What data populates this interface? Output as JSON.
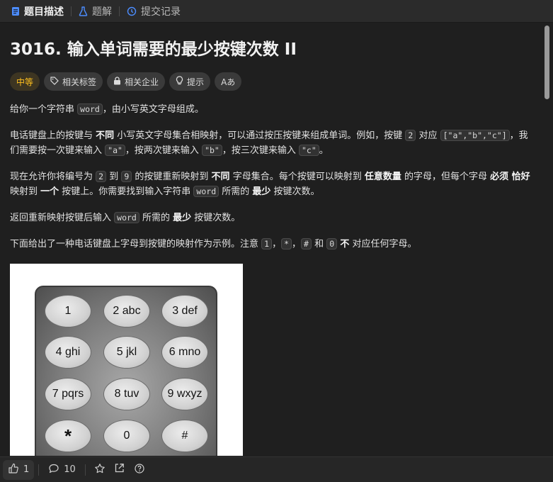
{
  "tabs": [
    {
      "label": "题目描述",
      "icon": "document-icon"
    },
    {
      "label": "题解",
      "icon": "flask-icon"
    },
    {
      "label": "提交记录",
      "icon": "history-icon"
    }
  ],
  "problem": {
    "title": "3016. 输入单词需要的最少按键次数 II",
    "difficulty": "中等",
    "tags": [
      {
        "label": "相关标签",
        "icon": "tag-icon"
      },
      {
        "label": "相关企业",
        "icon": "lock-icon"
      },
      {
        "label": "提示",
        "icon": "lightbulb-icon"
      },
      {
        "label": "Aあ",
        "icon": "translate-icon"
      }
    ],
    "p1": {
      "a": "给你一个字符串 ",
      "code": "word",
      "b": "，由小写英文字母组成。"
    },
    "p2": {
      "a": "电话键盘上的按键与 ",
      "b1": "不同",
      "c": " 小写英文字母集合相映射，可以通过按压按键来组成单词。例如，按键 ",
      "code1": "2",
      "d": " 对应 ",
      "code2": "[\"a\",\"b\",\"c\"]",
      "e": "，我们需要按一次键来输入 ",
      "code3": "\"a\"",
      "f": "，按两次键来输入 ",
      "code4": "\"b\"",
      "g": "，按三次键来输入 ",
      "code5": "\"c\"",
      "h": "。"
    },
    "p3": {
      "a": "现在允许你将编号为 ",
      "code1": "2",
      "b": " 到 ",
      "code2": "9",
      "c": " 的按键重新映射到 ",
      "b1": "不同",
      "d": " 字母集合。每个按键可以映射到 ",
      "b2": "任意数量",
      "e": " 的字母，但每个字母 ",
      "b3": "必须 恰好",
      "f": " 映射到 ",
      "b4": "一个",
      "g": " 按键上。你需要找到输入字符串 ",
      "code3": "word",
      "h": " 所需的 ",
      "b5": "最少",
      "i": " 按键次数。"
    },
    "p4": {
      "a": "返回重新映射按键后输入 ",
      "code": "word",
      "b": " 所需的 ",
      "b1": "最少",
      "c": " 按键次数。"
    },
    "p5": {
      "a": "下面给出了一种电话键盘上字母到按键的映射作为示例。注意 ",
      "code1": "1",
      "sep1": "，",
      "code2": "*",
      "sep2": "，",
      "code3": "#",
      "b": " 和 ",
      "code4": "0",
      "c": " ",
      "b1": "不",
      "d": " 对应任何字母。"
    },
    "keypad": [
      "1",
      "2 abc",
      "3 def",
      "4 ghi",
      "5 jkl",
      "6 mno",
      "7 pqrs",
      "8 tuv",
      "9 wxyz",
      "*",
      "0",
      "#"
    ]
  },
  "footer": {
    "likes": "1",
    "comments": "10"
  },
  "colors": {
    "background": "#1f1f1f",
    "difficulty_medium": "#ffc01e",
    "tab_active_icon": "#4c8dff"
  }
}
